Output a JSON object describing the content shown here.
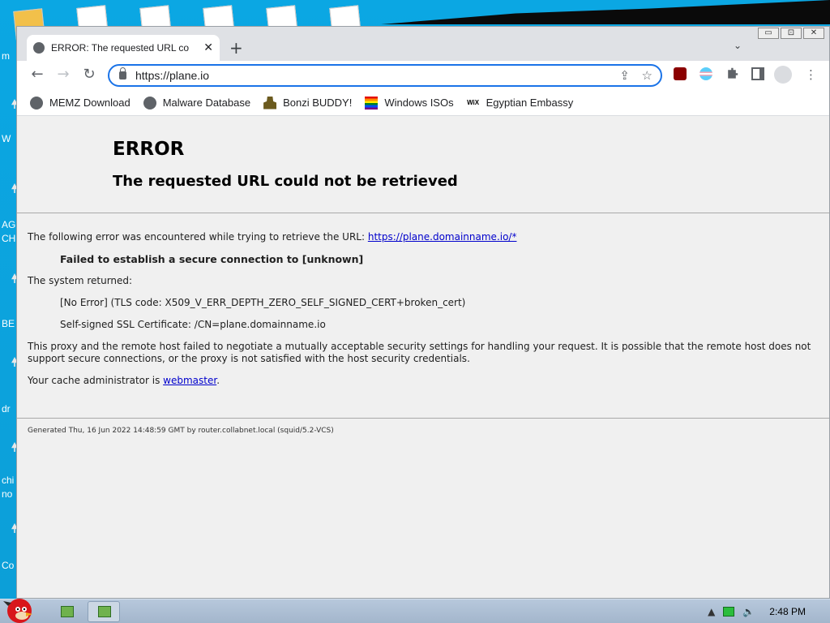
{
  "browser": {
    "tab_title": "ERROR: The requested URL co",
    "tab_close": "✕",
    "new_tab": "+",
    "tab_search": "⌄",
    "url": "https://plane.io",
    "window_controls": [
      "▭",
      "⊡",
      "✕"
    ],
    "bookmarks": [
      {
        "label": "MEMZ Download",
        "icon": "globe-icon"
      },
      {
        "label": "Malware Database",
        "icon": "globe-icon"
      },
      {
        "label": "Bonzi BUDDY!",
        "icon": "bonzi-icon"
      },
      {
        "label": "Windows ISOs",
        "icon": "rainbow-flag-icon"
      },
      {
        "label": "Egyptian Embassy",
        "icon": "wix-icon"
      }
    ],
    "extensions": [
      "ublock-icon",
      "trans-flag-icon",
      "puzzle-icon",
      "sidepanel-icon",
      "profile-icon",
      "menu-icon"
    ]
  },
  "page": {
    "title": "ERROR",
    "subtitle": "The requested URL could not be retrieved",
    "intro": "The following error was encountered while trying to retrieve the URL: ",
    "intro_link": "https://plane.domainname.io/*",
    "failure": "Failed to establish a secure connection to [unknown]",
    "system_returned": "The system returned:",
    "error_code": "[No Error] (TLS code: X509_V_ERR_DEPTH_ZERO_SELF_SIGNED_CERT+broken_cert)",
    "cert": "Self-signed SSL Certificate: /CN=plane.domainname.io",
    "explanation": "This proxy and the remote host failed to negotiate a mutually acceptable security settings for handling your request. It is possible that the remote host does not support secure connections, or the proxy is not satisfied with the host security credentials.",
    "admin_prefix": "Your cache administrator is ",
    "admin_link": "webmaster",
    "admin_suffix": ".",
    "footer": "Generated Thu, 16 Jun 2022 14:48:59 GMT by router.collabnet.local (squid/5.2-VCS)"
  },
  "desktop": {
    "labels": [
      "m",
      "W",
      "AG",
      "CH",
      "BE",
      "dr",
      "chi",
      "no",
      "Co"
    ]
  },
  "taskbar": {
    "time": "2:48 PM"
  },
  "colors": {
    "accent": "#1a73e8",
    "link": "#0000cc",
    "desktop_bg": "#0ba7e3"
  }
}
